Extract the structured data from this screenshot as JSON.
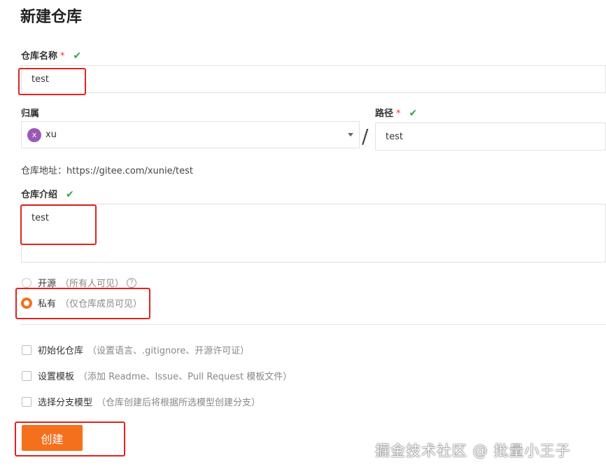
{
  "page": {
    "title": "新建仓库"
  },
  "repo_name": {
    "label": "仓库名称",
    "required_mark": "*",
    "value": "test"
  },
  "owner": {
    "label": "归属",
    "avatar_letter": "x",
    "value": "xu"
  },
  "path": {
    "separator": "/",
    "label": "路径",
    "required_mark": "*",
    "value": "test"
  },
  "address": {
    "label": "仓库地址：",
    "url": "https://gitee.com/xunie/test"
  },
  "description": {
    "label": "仓库介绍",
    "value": "test"
  },
  "visibility": {
    "public_label": "开源",
    "public_hint": "（所有人可见）",
    "help_icon": "?",
    "private_label": "私有",
    "private_hint": "（仅仓库成员可见）",
    "selected": "private"
  },
  "options": [
    {
      "label": "初始化仓库",
      "hint": "（设置语言、.gitignore、开源许可证）"
    },
    {
      "label": "设置模板",
      "hint": "（添加 Readme、Issue、Pull Request 模板文件）"
    },
    {
      "label": "选择分支模型",
      "hint": "（仓库创建后将根据所选模型创建分支）"
    }
  ],
  "create_button": {
    "label": "创建"
  },
  "watermark": "掘金技术社区 @ 批量小王子",
  "icons": {
    "check": "check-icon",
    "caret": "caret-down-icon",
    "help": "help-icon"
  },
  "colors": {
    "accent": "#f5701d",
    "check": "#2ea44f",
    "annotation": "#e0231f",
    "required": "#e33333"
  }
}
